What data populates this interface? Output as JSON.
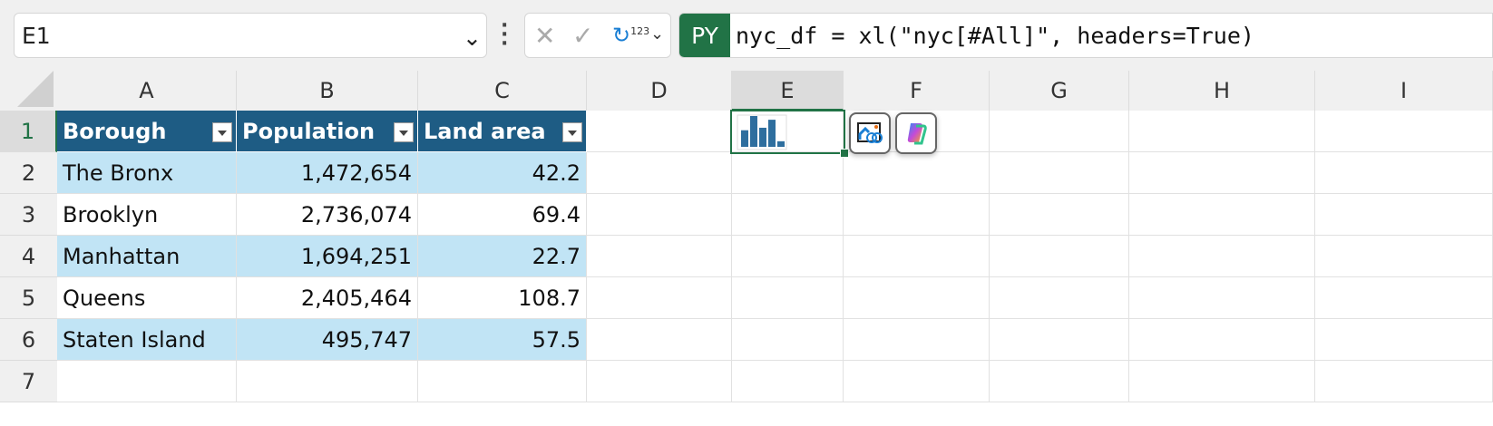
{
  "namebox": {
    "value": "E1"
  },
  "formula_bar": {
    "cancel_icon": "x-icon",
    "enter_icon": "check-icon",
    "mode_label": "123",
    "mode_badge": "PY",
    "formula": "nyc_df = xl(\"nyc[#All]\", headers=True)",
    "badge_color": "#217346"
  },
  "columns": [
    "A",
    "B",
    "C",
    "D",
    "E",
    "F",
    "G",
    "H",
    "I"
  ],
  "rows": [
    "1",
    "2",
    "3",
    "4",
    "5",
    "6",
    "7"
  ],
  "table": {
    "headers": [
      "Borough",
      "Population",
      "Land area"
    ],
    "rows": [
      [
        "The Bronx",
        "1,472,654",
        "42.2"
      ],
      [
        "Brooklyn",
        "2,736,074",
        "69.4"
      ],
      [
        "Manhattan",
        "1,694,251",
        "22.7"
      ],
      [
        "Queens",
        "2,405,464",
        "108.7"
      ],
      [
        "Staten Island",
        "495,747",
        "57.5"
      ]
    ],
    "header_color": "#1e5c84",
    "band_color": "#c1e4f5"
  },
  "selected_cell": "E1",
  "cell_E1": {
    "content": "bar-chart-image",
    "bar_color": "#2e6e9e"
  },
  "floating_buttons": [
    {
      "icon": "linked-image-icon"
    },
    {
      "icon": "copilot-icon"
    }
  ]
}
